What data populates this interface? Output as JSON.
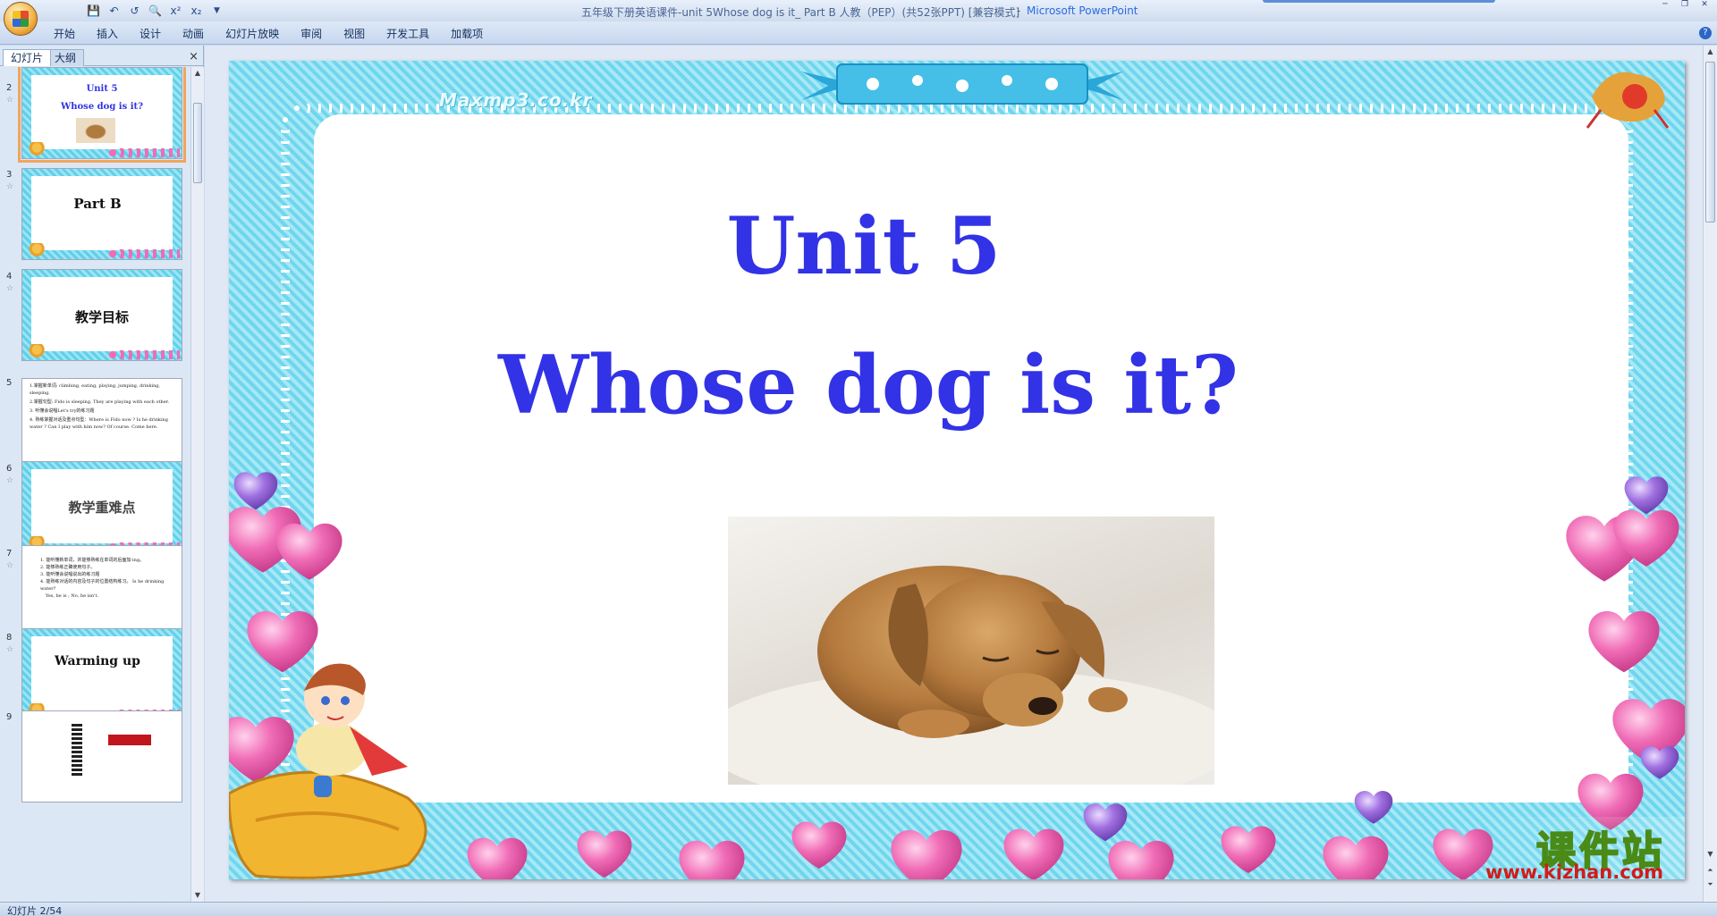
{
  "window": {
    "title_doc": "五年级下册英语课件-unit 5Whose dog is it_ Part B 人教（PEP）(共52张PPT) [兼容模式]",
    "title_sep": "-",
    "title_app": "Microsoft PowerPoint"
  },
  "ribbon": {
    "tabs": [
      "开始",
      "插入",
      "设计",
      "动画",
      "幻灯片放映",
      "审阅",
      "视图",
      "开发工具",
      "加载项"
    ]
  },
  "left_pane": {
    "tab_slides": "幻灯片",
    "tab_outline": "大纲",
    "close": "×"
  },
  "thumbnails": [
    {
      "num": "2",
      "title": "Unit 5",
      "subtitle": "Whose dog is it?",
      "selected": true
    },
    {
      "num": "3",
      "title": "Part B"
    },
    {
      "num": "4",
      "title": "教学目标"
    },
    {
      "num": "5",
      "lines": [
        "1.掌握新单词: climbing, eating, playing, jumping, drinking, sleeping.",
        "2.掌握句型: Fido is sleeping. They are playing with each other.",
        "3. 听懂会说唱Let's try的练习题",
        "4. 熟练掌握对话及重点句型：Where is Fido now ? Is he drinking water ? Can I play with him now? Of course. Come here."
      ]
    },
    {
      "num": "6",
      "title": "教学重难点"
    },
    {
      "num": "7",
      "lines": [
        "1. 能听懂新单词，并能够熟练在单词的后面加-ing。",
        "2. 能够熟练正确使用句子。",
        "3. 能听懂会说唱说出的练习题",
        "4. 能熟练对话的内容及句子的位置结构练习。 Is he drinking water?",
        "Yes, he is ; No, he isn't."
      ]
    },
    {
      "num": "8",
      "title": "Warming up"
    },
    {
      "num": "9"
    }
  ],
  "slide": {
    "site_mark": "Maxmp3.co.kr",
    "title": "Unit 5",
    "subtitle": "Whose dog is it?",
    "watermark_cn": "课件站",
    "watermark_url": "www.kjzhan.com"
  },
  "status": {
    "slide_counter": "幻灯片 2/54"
  },
  "colors": {
    "title_blue": "#3232e6",
    "frame_cyan": "#6fd6ee",
    "heart_pink": "#f06cb6",
    "selected_outline": "#f1a65a"
  }
}
